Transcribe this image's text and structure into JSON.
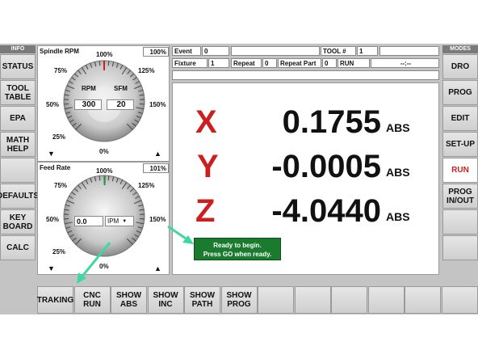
{
  "left_menu": {
    "header": "INFO",
    "items": [
      "STATUS",
      "TOOL\nTABLE",
      "EPA",
      "MATH\nHELP",
      "",
      "DEFAULTS",
      "KEY\nBOARD",
      "CALC"
    ]
  },
  "right_menu": {
    "header": "MODES",
    "items": [
      "DRO",
      "PROG",
      "EDIT",
      "SET-UP",
      "RUN",
      "PROG\nIN/OUT",
      "",
      ""
    ],
    "active": "RUN",
    "active_color": "#cc1f1f"
  },
  "spindle": {
    "title": "Spindle RPM",
    "override": "100%",
    "scale_top": "100%",
    "scale_75": "75%",
    "scale_125": "125%",
    "scale_50": "50%",
    "scale_150": "150%",
    "scale_25": "25%",
    "scale_0": "0%",
    "rpm_label": "RPM",
    "sfm_label": "SFM",
    "rpm_value": "300",
    "sfm_value": "20",
    "override_level": 1.0
  },
  "feed": {
    "title": "Feed Rate",
    "override": "101%",
    "scale_top": "100%",
    "scale_75": "75%",
    "scale_125": "125%",
    "scale_50": "50%",
    "scale_150": "150%",
    "scale_25": "25%",
    "scale_0": "0%",
    "value": "0.0",
    "unit": "IPM",
    "override_level": 1.01
  },
  "status": {
    "event_label": "Event",
    "event_value": "0",
    "tool_label": "TOOL #",
    "tool_value": "1",
    "fixture_label": "Fixture",
    "fixture_value": "1",
    "repeat_label": "Repeat",
    "repeat_value": "0",
    "repeat_part_label": "Repeat Part",
    "repeat_part_value": "0",
    "run_label": "RUN",
    "time_value": "--:--"
  },
  "dro": {
    "x_axis": "X",
    "x_value": "0.1755",
    "y_axis": "Y",
    "y_value": "-0.0005",
    "z_axis": "Z",
    "z_value": "-4.0440",
    "mode": "ABS",
    "axis_color": "#cc1f1f"
  },
  "message": {
    "line1": "Ready to begin.",
    "line2": "Press GO when ready.",
    "color": "#1a7a2e"
  },
  "bottom_bar": {
    "items": [
      "TRAKING",
      "CNC\nRUN",
      "SHOW\nABS",
      "SHOW\nINC",
      "SHOW\nPATH",
      "SHOW\nPROG",
      "",
      "",
      "",
      "",
      "",
      ""
    ]
  },
  "annotation_color": "#3fd9a0"
}
